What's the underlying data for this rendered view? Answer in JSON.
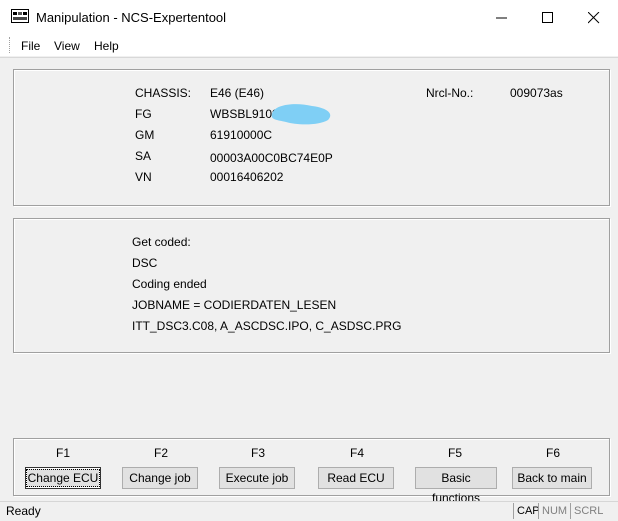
{
  "window": {
    "title": "Manipulation - NCS-Expertentool",
    "controls": [
      "minimize",
      "maximize",
      "close"
    ]
  },
  "menu": [
    "File",
    "View",
    "Help"
  ],
  "vehicle_info": {
    "chassis_label": "CHASSIS:",
    "chassis_value": "E46 (E46)",
    "nrcl_label": "Nrcl-No.:",
    "nrcl_value": "009073as",
    "fg_label": "FG",
    "fg_value": "WBSBL9109",
    "gm_label": "GM",
    "gm_value": "61910000C",
    "sa_label": "SA",
    "sa_value": "00003A00C0BC74E0P",
    "vn_label": "VN",
    "vn_value": "00016406202"
  },
  "log": [
    "Get coded:",
    "DSC",
    "Coding ended",
    "JOBNAME = CODIERDATEN_LESEN",
    "ITT_DSC3.C08, A_ASCDSC.IPO, C_ASDSC.PRG"
  ],
  "function_keys": [
    {
      "key": "F1",
      "label": "Change ECU"
    },
    {
      "key": "F2",
      "label": "Change job"
    },
    {
      "key": "F3",
      "label": "Execute job"
    },
    {
      "key": "F4",
      "label": "Read ECU"
    },
    {
      "key": "F5",
      "label": "Basic functions"
    },
    {
      "key": "F6",
      "label": "Back to main"
    }
  ],
  "status": {
    "text": "Ready",
    "indicators": [
      "CAP",
      "NUM",
      "SCRL"
    ]
  },
  "colors": {
    "redaction_blob": "#7fcff5"
  }
}
